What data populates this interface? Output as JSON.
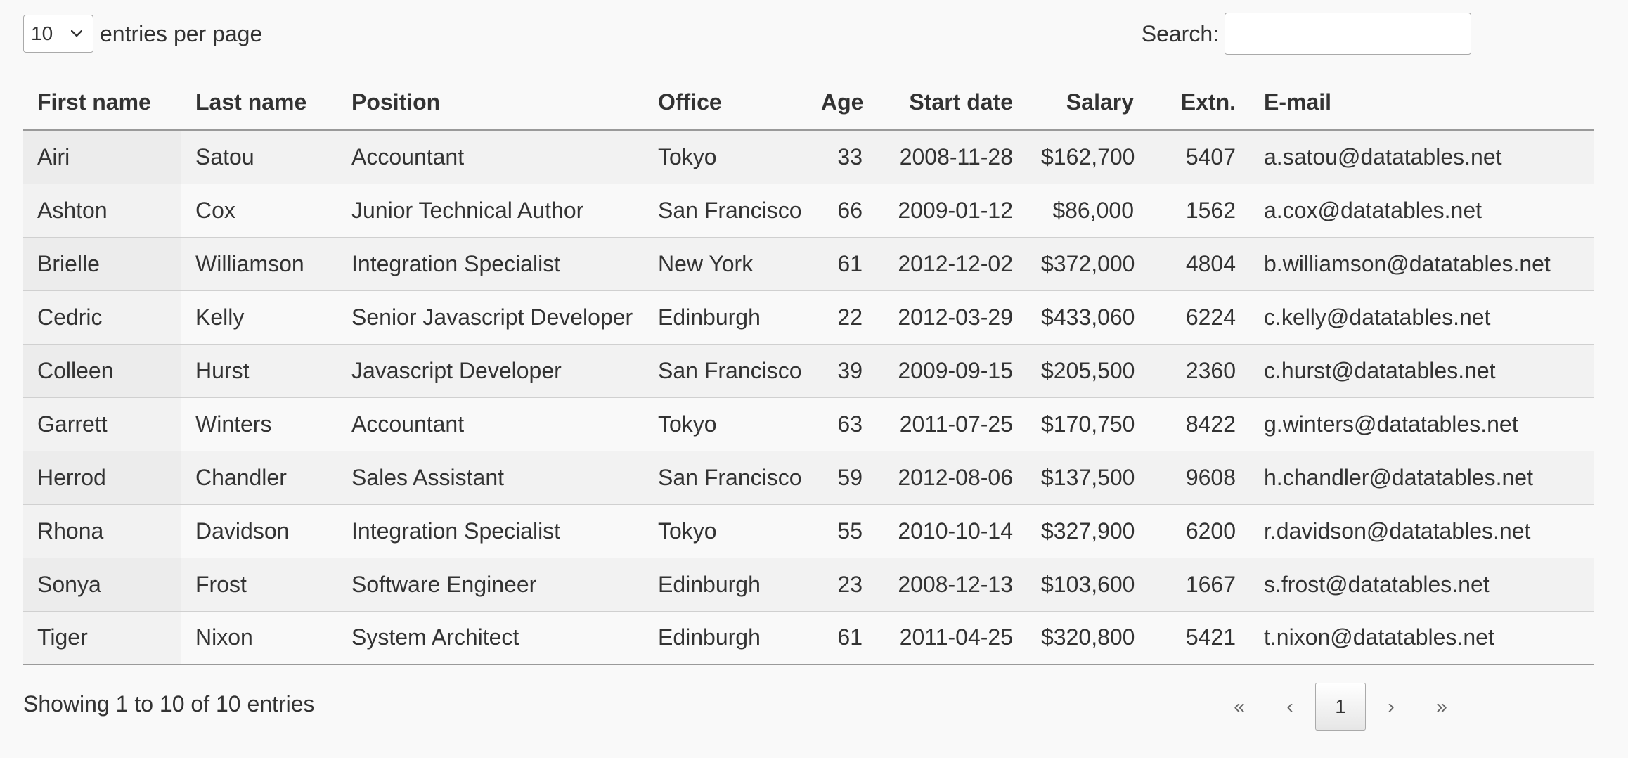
{
  "length": {
    "selected": "10",
    "label": "entries per page"
  },
  "search": {
    "label": "Search:",
    "value": ""
  },
  "table": {
    "headers": [
      "First name",
      "Last name",
      "Position",
      "Office",
      "Age",
      "Start date",
      "Salary",
      "Extn.",
      "E-mail"
    ],
    "rows": [
      [
        "Airi",
        "Satou",
        "Accountant",
        "Tokyo",
        "33",
        "2008-11-28",
        "$162,700",
        "5407",
        "a.satou@datatables.net"
      ],
      [
        "Ashton",
        "Cox",
        "Junior Technical Author",
        "San Francisco",
        "66",
        "2009-01-12",
        "$86,000",
        "1562",
        "a.cox@datatables.net"
      ],
      [
        "Brielle",
        "Williamson",
        "Integration Specialist",
        "New York",
        "61",
        "2012-12-02",
        "$372,000",
        "4804",
        "b.williamson@datatables.net"
      ],
      [
        "Cedric",
        "Kelly",
        "Senior Javascript Developer",
        "Edinburgh",
        "22",
        "2012-03-29",
        "$433,060",
        "6224",
        "c.kelly@datatables.net"
      ],
      [
        "Colleen",
        "Hurst",
        "Javascript Developer",
        "San Francisco",
        "39",
        "2009-09-15",
        "$205,500",
        "2360",
        "c.hurst@datatables.net"
      ],
      [
        "Garrett",
        "Winters",
        "Accountant",
        "Tokyo",
        "63",
        "2011-07-25",
        "$170,750",
        "8422",
        "g.winters@datatables.net"
      ],
      [
        "Herrod",
        "Chandler",
        "Sales Assistant",
        "San Francisco",
        "59",
        "2012-08-06",
        "$137,500",
        "9608",
        "h.chandler@datatables.net"
      ],
      [
        "Rhona",
        "Davidson",
        "Integration Specialist",
        "Tokyo",
        "55",
        "2010-10-14",
        "$327,900",
        "6200",
        "r.davidson@datatables.net"
      ],
      [
        "Sonya",
        "Frost",
        "Software Engineer",
        "Edinburgh",
        "23",
        "2008-12-13",
        "$103,600",
        "1667",
        "s.frost@datatables.net"
      ],
      [
        "Tiger",
        "Nixon",
        "System Architect",
        "Edinburgh",
        "61",
        "2011-04-25",
        "$320,800",
        "5421",
        "t.nixon@datatables.net"
      ]
    ]
  },
  "footer": {
    "info": "Showing 1 to 10 of 10 entries",
    "paging": {
      "first": "«",
      "previous": "‹",
      "current": "1",
      "next": "›",
      "last": "»"
    }
  },
  "icons": {
    "select_arrow": "chevron-down-icon"
  }
}
